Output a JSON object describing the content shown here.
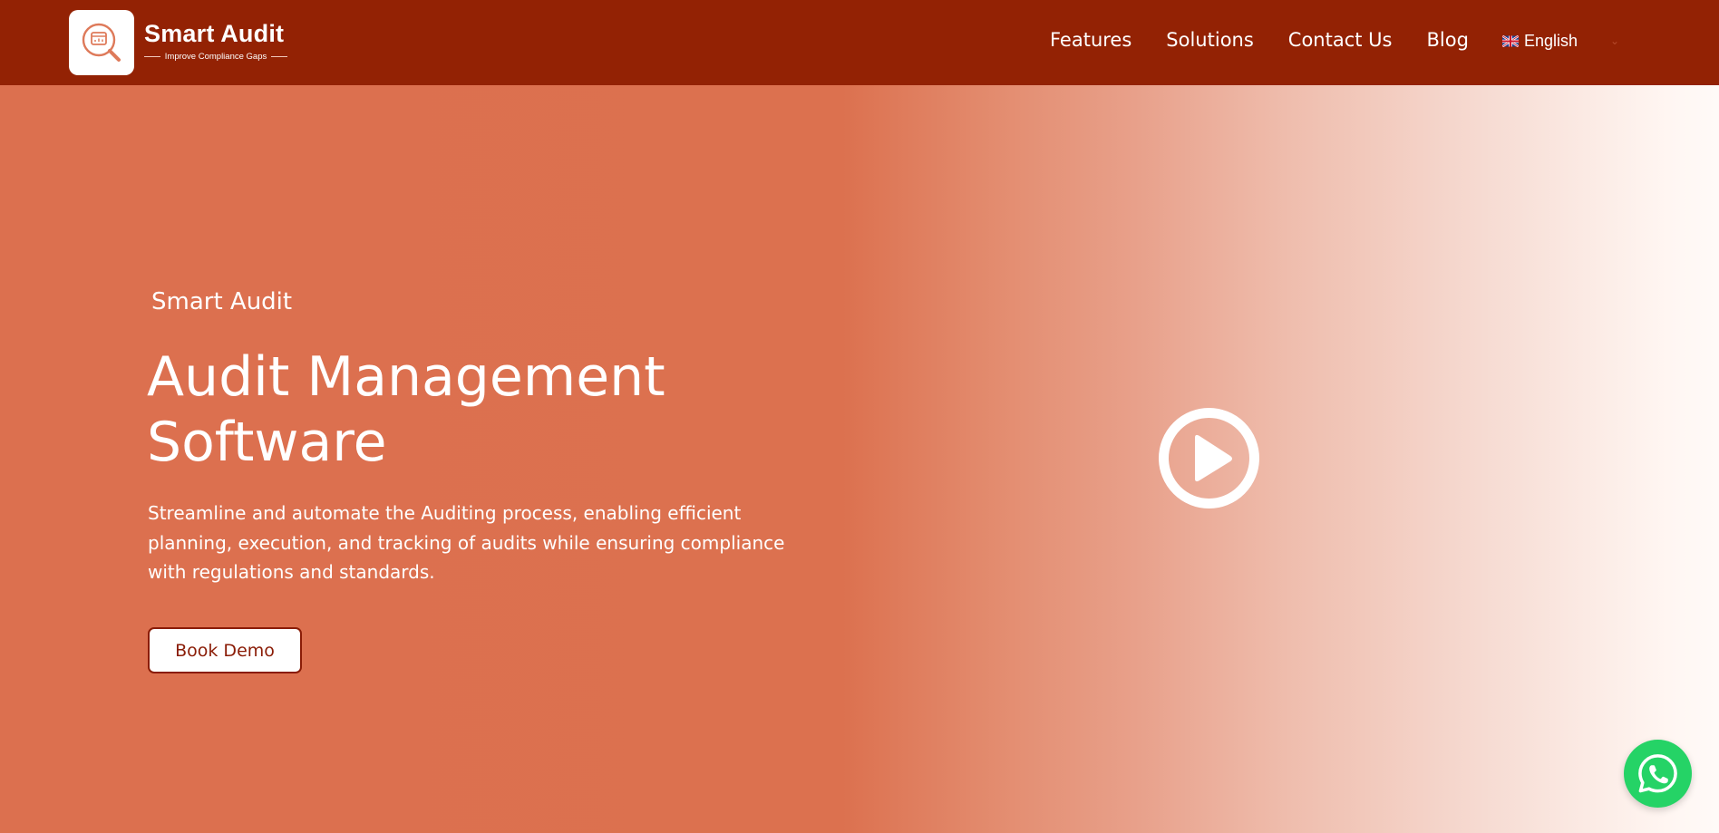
{
  "brand": {
    "title": "Smart Audit",
    "tagline": "Improve Compliance Gaps",
    "logo_icon": "audit-search-icon"
  },
  "nav": {
    "items": [
      "Features",
      "Solutions",
      "Contact Us",
      "Blog"
    ],
    "language": {
      "selected": "English",
      "flag_icon": "uk-flag-icon",
      "caret_icon": "chevron-down-icon"
    }
  },
  "hero": {
    "eyebrow": "Smart Audit",
    "title": "Audit Management Software",
    "description": "Streamline and automate the Auditing process, enabling efficient planning, execution, and tracking of audits while ensuring compliance with regulations and standards.",
    "cta_label": "Book Demo",
    "play_icon": "play-icon"
  },
  "floating": {
    "whatsapp_icon": "whatsapp-icon"
  },
  "colors": {
    "header_bg": "#932204",
    "hero_bg_start": "#dc704f",
    "hero_bg_end": "#fffaf8",
    "cta_text": "#8a1c06",
    "whatsapp_green": "#25d366"
  }
}
